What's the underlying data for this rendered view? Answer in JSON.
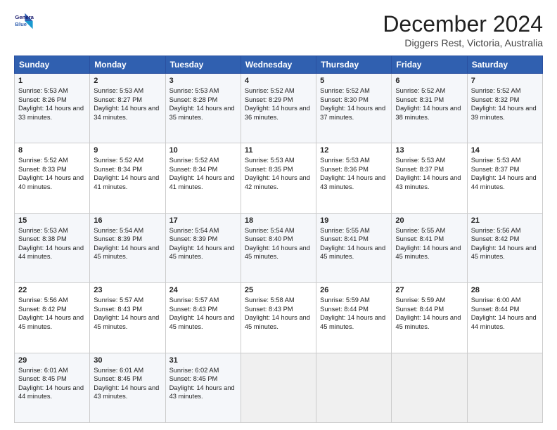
{
  "logo": {
    "line1": "General",
    "line2": "Blue"
  },
  "title": "December 2024",
  "subtitle": "Diggers Rest, Victoria, Australia",
  "days": [
    "Sunday",
    "Monday",
    "Tuesday",
    "Wednesday",
    "Thursday",
    "Friday",
    "Saturday"
  ],
  "weeks": [
    [
      {
        "day": 1,
        "sunrise": "5:53 AM",
        "sunset": "8:26 PM",
        "daylight": "14 hours and 33 minutes."
      },
      {
        "day": 2,
        "sunrise": "5:53 AM",
        "sunset": "8:27 PM",
        "daylight": "14 hours and 34 minutes."
      },
      {
        "day": 3,
        "sunrise": "5:53 AM",
        "sunset": "8:28 PM",
        "daylight": "14 hours and 35 minutes."
      },
      {
        "day": 4,
        "sunrise": "5:52 AM",
        "sunset": "8:29 PM",
        "daylight": "14 hours and 36 minutes."
      },
      {
        "day": 5,
        "sunrise": "5:52 AM",
        "sunset": "8:30 PM",
        "daylight": "14 hours and 37 minutes."
      },
      {
        "day": 6,
        "sunrise": "5:52 AM",
        "sunset": "8:31 PM",
        "daylight": "14 hours and 38 minutes."
      },
      {
        "day": 7,
        "sunrise": "5:52 AM",
        "sunset": "8:32 PM",
        "daylight": "14 hours and 39 minutes."
      }
    ],
    [
      {
        "day": 8,
        "sunrise": "5:52 AM",
        "sunset": "8:33 PM",
        "daylight": "14 hours and 40 minutes."
      },
      {
        "day": 9,
        "sunrise": "5:52 AM",
        "sunset": "8:34 PM",
        "daylight": "14 hours and 41 minutes."
      },
      {
        "day": 10,
        "sunrise": "5:52 AM",
        "sunset": "8:34 PM",
        "daylight": "14 hours and 41 minutes."
      },
      {
        "day": 11,
        "sunrise": "5:53 AM",
        "sunset": "8:35 PM",
        "daylight": "14 hours and 42 minutes."
      },
      {
        "day": 12,
        "sunrise": "5:53 AM",
        "sunset": "8:36 PM",
        "daylight": "14 hours and 43 minutes."
      },
      {
        "day": 13,
        "sunrise": "5:53 AM",
        "sunset": "8:37 PM",
        "daylight": "14 hours and 43 minutes."
      },
      {
        "day": 14,
        "sunrise": "5:53 AM",
        "sunset": "8:37 PM",
        "daylight": "14 hours and 44 minutes."
      }
    ],
    [
      {
        "day": 15,
        "sunrise": "5:53 AM",
        "sunset": "8:38 PM",
        "daylight": "14 hours and 44 minutes."
      },
      {
        "day": 16,
        "sunrise": "5:54 AM",
        "sunset": "8:39 PM",
        "daylight": "14 hours and 45 minutes."
      },
      {
        "day": 17,
        "sunrise": "5:54 AM",
        "sunset": "8:39 PM",
        "daylight": "14 hours and 45 minutes."
      },
      {
        "day": 18,
        "sunrise": "5:54 AM",
        "sunset": "8:40 PM",
        "daylight": "14 hours and 45 minutes."
      },
      {
        "day": 19,
        "sunrise": "5:55 AM",
        "sunset": "8:41 PM",
        "daylight": "14 hours and 45 minutes."
      },
      {
        "day": 20,
        "sunrise": "5:55 AM",
        "sunset": "8:41 PM",
        "daylight": "14 hours and 45 minutes."
      },
      {
        "day": 21,
        "sunrise": "5:56 AM",
        "sunset": "8:42 PM",
        "daylight": "14 hours and 45 minutes."
      }
    ],
    [
      {
        "day": 22,
        "sunrise": "5:56 AM",
        "sunset": "8:42 PM",
        "daylight": "14 hours and 45 minutes."
      },
      {
        "day": 23,
        "sunrise": "5:57 AM",
        "sunset": "8:43 PM",
        "daylight": "14 hours and 45 minutes."
      },
      {
        "day": 24,
        "sunrise": "5:57 AM",
        "sunset": "8:43 PM",
        "daylight": "14 hours and 45 minutes."
      },
      {
        "day": 25,
        "sunrise": "5:58 AM",
        "sunset": "8:43 PM",
        "daylight": "14 hours and 45 minutes."
      },
      {
        "day": 26,
        "sunrise": "5:59 AM",
        "sunset": "8:44 PM",
        "daylight": "14 hours and 45 minutes."
      },
      {
        "day": 27,
        "sunrise": "5:59 AM",
        "sunset": "8:44 PM",
        "daylight": "14 hours and 45 minutes."
      },
      {
        "day": 28,
        "sunrise": "6:00 AM",
        "sunset": "8:44 PM",
        "daylight": "14 hours and 44 minutes."
      }
    ],
    [
      {
        "day": 29,
        "sunrise": "6:01 AM",
        "sunset": "8:45 PM",
        "daylight": "14 hours and 44 minutes."
      },
      {
        "day": 30,
        "sunrise": "6:01 AM",
        "sunset": "8:45 PM",
        "daylight": "14 hours and 43 minutes."
      },
      {
        "day": 31,
        "sunrise": "6:02 AM",
        "sunset": "8:45 PM",
        "daylight": "14 hours and 43 minutes."
      },
      null,
      null,
      null,
      null
    ]
  ]
}
